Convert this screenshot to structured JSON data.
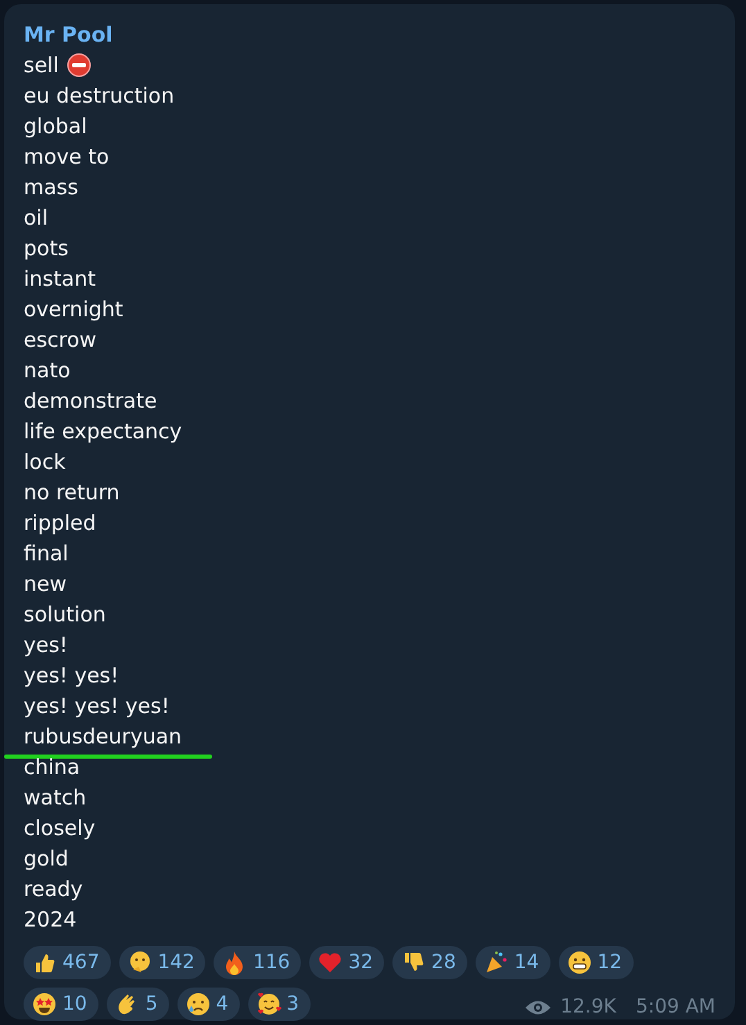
{
  "message": {
    "sender": "Mr Pool",
    "lines": [
      {
        "text": "sell",
        "kind": "stop-sign",
        "underlined": false
      },
      {
        "text": "eu destruction",
        "underlined": false
      },
      {
        "text": "global",
        "underlined": false
      },
      {
        "text": "move to",
        "underlined": false
      },
      {
        "text": "mass",
        "underlined": false
      },
      {
        "text": "oil",
        "underlined": false
      },
      {
        "text": "pots",
        "underlined": false
      },
      {
        "text": "instant",
        "underlined": false
      },
      {
        "text": "overnight",
        "underlined": false
      },
      {
        "text": "escrow",
        "underlined": false
      },
      {
        "text": "nato",
        "underlined": false
      },
      {
        "text": "demonstrate",
        "underlined": false
      },
      {
        "text": "life expectancy",
        "underlined": false
      },
      {
        "text": "lock",
        "underlined": false
      },
      {
        "text": "no return",
        "underlined": false
      },
      {
        "text": "rippled",
        "underlined": false
      },
      {
        "text": "final",
        "underlined": false
      },
      {
        "text": "new",
        "underlined": false
      },
      {
        "text": "solution",
        "underlined": false
      },
      {
        "text": "yes!",
        "underlined": false
      },
      {
        "text": "yes! yes!",
        "underlined": false
      },
      {
        "text": "yes! yes! yes!",
        "underlined": false
      },
      {
        "text": "rubusdeuryuan",
        "underlined": true
      },
      {
        "text": "china",
        "underlined": false
      },
      {
        "text": "watch",
        "underlined": false
      },
      {
        "text": "closely",
        "underlined": false
      },
      {
        "text": "gold",
        "underlined": false
      },
      {
        "text": "ready",
        "underlined": false
      },
      {
        "text": "2024",
        "underlined": false
      }
    ],
    "reactions": [
      {
        "kind": "thumbs-up",
        "count": "467"
      },
      {
        "kind": "thinking",
        "count": "142"
      },
      {
        "kind": "fire",
        "count": "116"
      },
      {
        "kind": "heart",
        "count": "32"
      },
      {
        "kind": "thumbs-down",
        "count": "28"
      },
      {
        "kind": "party",
        "count": "14"
      },
      {
        "kind": "grin",
        "count": "12"
      },
      {
        "kind": "star-struck",
        "count": "10"
      },
      {
        "kind": "clap",
        "count": "5"
      },
      {
        "kind": "sad",
        "count": "4"
      },
      {
        "kind": "hearts-face",
        "count": "3"
      }
    ],
    "views": "12.9K",
    "time": "5:09 AM"
  }
}
